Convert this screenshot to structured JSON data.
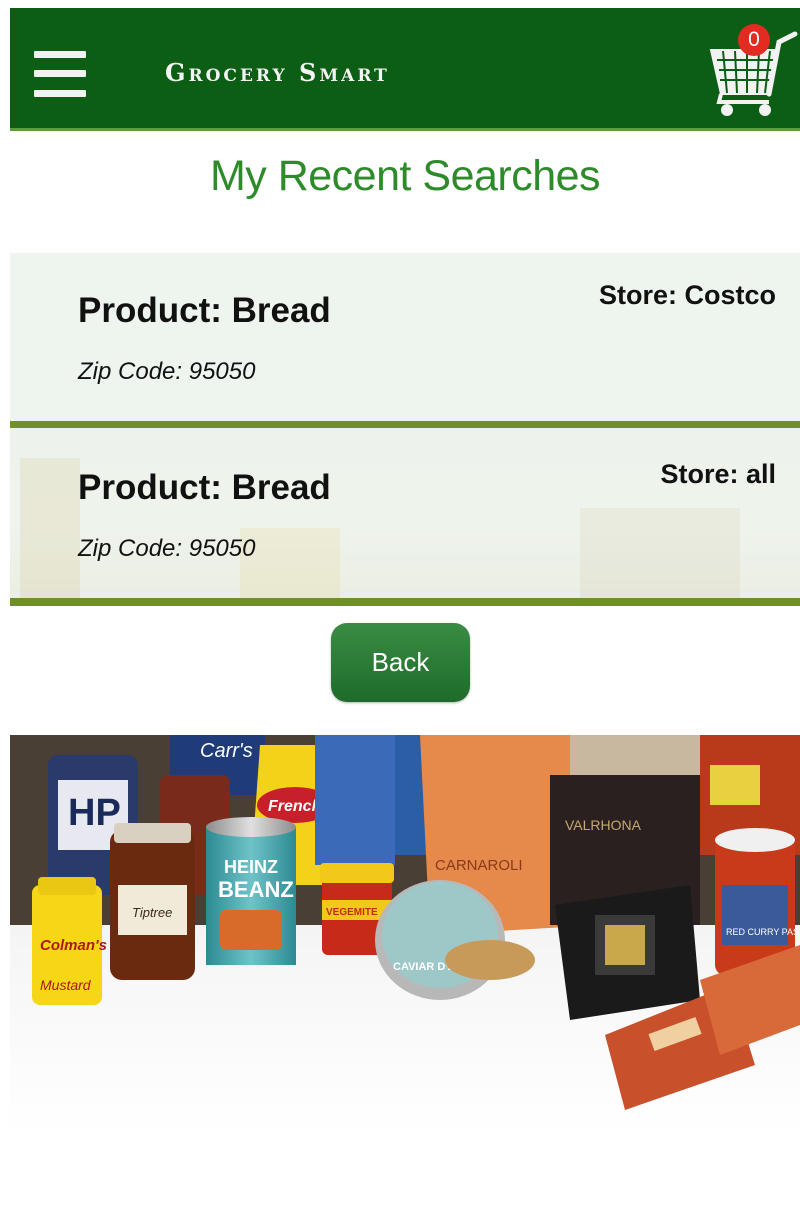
{
  "header": {
    "app_title": "Grocery Smart",
    "cart_count": "0",
    "menu_icon": "hamburger-menu-icon",
    "cart_icon": "shopping-cart-icon",
    "brand_color": "#0b5e14",
    "badge_color": "#e32b22"
  },
  "page": {
    "title": "My Recent Searches",
    "title_color": "#2e8b2a"
  },
  "searches": [
    {
      "product": "Product: Bread",
      "zip": "Zip Code: 95050",
      "store": "Store: Costco"
    },
    {
      "product": "Product: Bread",
      "zip": "Zip Code: 95050",
      "store": "Store: all"
    }
  ],
  "back_button": {
    "label": "Back"
  },
  "photo_labels": {
    "hp": "HP",
    "carrs": "Carr's",
    "frenchs": "French's",
    "heinz": "HEINZ",
    "beanz": "BEANZ",
    "vegemite": "VEGEMITE",
    "carnaroli": "CARNAROLI",
    "valrhona": "VALRHONA",
    "caviar": "CAVIAR D'ARAN",
    "colmans": "Colman's",
    "mustard": "Mustard",
    "tiptree": "Tiptree",
    "red_curry": "RED CURRY PASTE"
  }
}
